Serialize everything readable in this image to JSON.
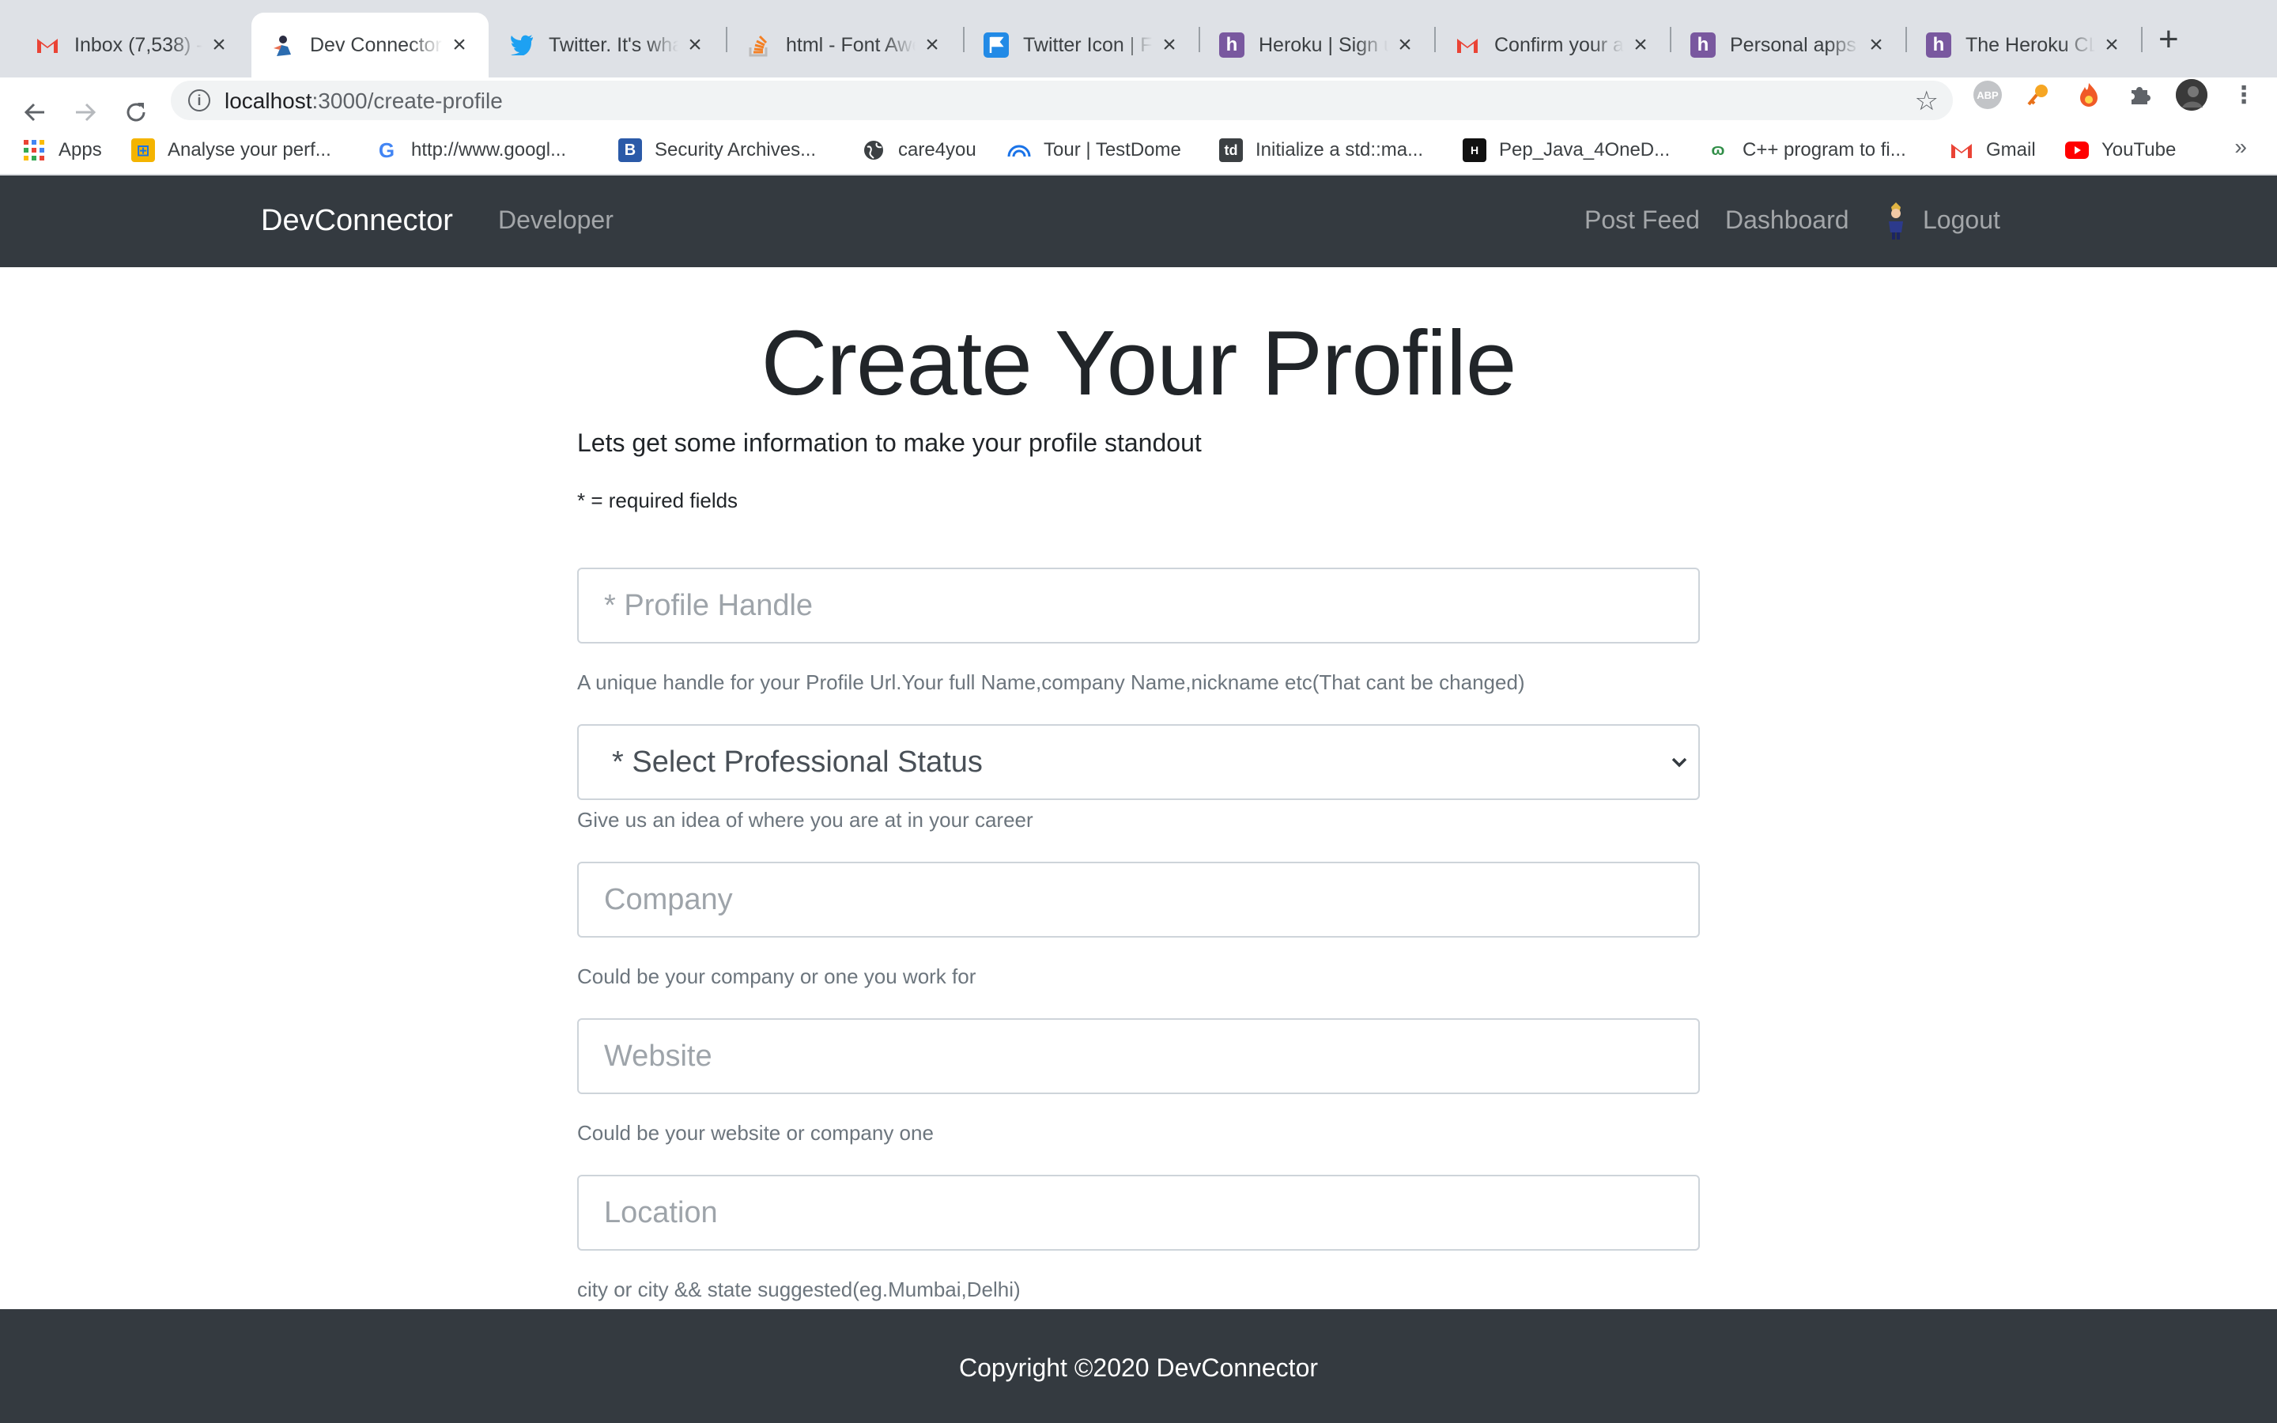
{
  "browser": {
    "tabs": [
      {
        "title": "Inbox (7,538) - ",
        "icon": "gmail-icon",
        "active": false
      },
      {
        "title": "Dev Connector",
        "icon": "devconnector-icon",
        "active": true
      },
      {
        "title": "Twitter. It's what",
        "icon": "twitter-icon",
        "active": false
      },
      {
        "title": "html - Font Awe",
        "icon": "stackoverflow-icon",
        "active": false
      },
      {
        "title": "Twitter Icon | F",
        "icon": "fontawesome-flag-icon",
        "active": false
      },
      {
        "title": "Heroku | Sign u",
        "icon": "heroku-icon",
        "active": false
      },
      {
        "title": "Confirm your a",
        "icon": "gmail-icon",
        "active": false
      },
      {
        "title": "Personal apps",
        "icon": "heroku-icon",
        "active": false
      },
      {
        "title": "The Heroku CL",
        "icon": "heroku-icon",
        "active": false
      }
    ],
    "url_host": "localhost",
    "url_path": ":3000/create-profile",
    "bookmarks": [
      {
        "label": "Apps",
        "icon": "apps-grid-icon"
      },
      {
        "label": "Analyse your perf...",
        "icon": "pagespeed-icon"
      },
      {
        "label": "http://www.googl...",
        "icon": "google-icon"
      },
      {
        "label": "Security Archives...",
        "icon": "b-letter-icon"
      },
      {
        "label": "care4you",
        "icon": "globe-icon"
      },
      {
        "label": "Tour | TestDome",
        "icon": "testdome-icon"
      },
      {
        "label": "Initialize a std::ma...",
        "icon": "td-icon"
      },
      {
        "label": "Pep_Java_4OneD...",
        "icon": "hackerearth-icon"
      },
      {
        "label": "C++ program to fi...",
        "icon": "geeksforgeeks-icon"
      },
      {
        "label": "Gmail",
        "icon": "gmail-icon"
      },
      {
        "label": "YouTube",
        "icon": "youtube-icon"
      }
    ],
    "bookmarks_more": "»"
  },
  "navbar": {
    "brand": "DevConnector",
    "developer_link": "Developer",
    "post_feed": "Post Feed",
    "dashboard": "Dashboard",
    "logout": "Logout"
  },
  "page": {
    "title": "Create Your Profile",
    "lead": "Lets get some information to make your profile standout",
    "required_note": "* = required fields",
    "fields": {
      "handle": {
        "placeholder": "* Profile Handle",
        "hint": "A unique handle for your Profile Url.Your full Name,company Name,nickname etc(That cant be changed)"
      },
      "status": {
        "value": "* Select Professional Status",
        "hint": "Give us an idea of where you are at in your career"
      },
      "company": {
        "placeholder": "Company",
        "hint": "Could be your company or one you work for"
      },
      "website": {
        "placeholder": "Website",
        "hint": "Could be your website or company one"
      },
      "location": {
        "placeholder": "Location",
        "hint": "city or city && state suggested(eg.Mumbai,Delhi)"
      }
    }
  },
  "footer": {
    "copyright": "Copyright ©2020 DevConnector"
  },
  "colors": {
    "navbar_bg": "#343a40",
    "tabbar_bg": "#dee1e6",
    "input_border": "#ced4da",
    "hint_text": "#6c757d"
  }
}
